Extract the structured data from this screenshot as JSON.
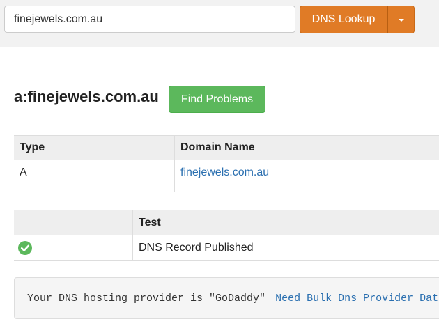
{
  "search": {
    "value": "finejewels.com.au"
  },
  "toolbar": {
    "lookup_label": "DNS Lookup",
    "dropdown_icon": "caret-down-icon"
  },
  "header": {
    "title": "a:finejewels.com.au",
    "find_problems_label": "Find Problems"
  },
  "records_table": {
    "columns": [
      "Type",
      "Domain Name"
    ],
    "rows": [
      {
        "type": "A",
        "domain": "finejewels.com.au"
      }
    ]
  },
  "tests_table": {
    "columns": [
      "",
      "Test"
    ],
    "rows": [
      {
        "status_icon": "check-circle-icon",
        "status_color": "#5cb85c",
        "test": "DNS Record Published"
      }
    ]
  },
  "provider": {
    "text": "Your DNS hosting provider is \"GoDaddy\"",
    "link_label": "Need Bulk Dns Provider Data?"
  },
  "colors": {
    "accent_orange": "#e07b26",
    "success_green": "#5cb85c",
    "link_blue": "#2a6fb0"
  }
}
